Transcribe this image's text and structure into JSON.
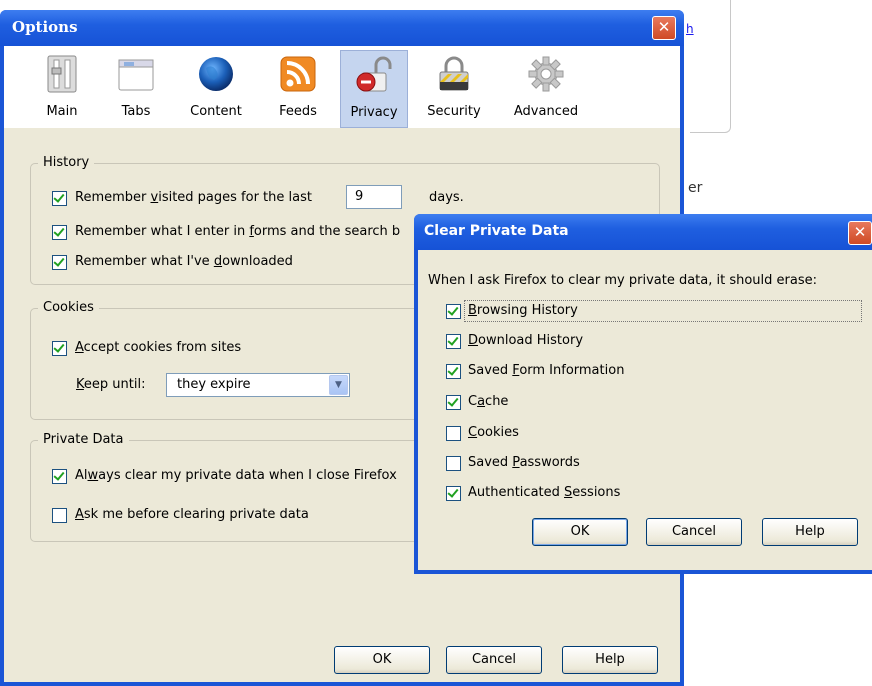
{
  "background": {
    "link_text": "h",
    "side_text": "er"
  },
  "options": {
    "title": "Options",
    "close_glyph": "✕",
    "tabs": [
      {
        "label": "Main",
        "icon": "main-switch-icon"
      },
      {
        "label": "Tabs",
        "icon": "tabs-window-icon"
      },
      {
        "label": "Content",
        "icon": "globe-icon"
      },
      {
        "label": "Feeds",
        "icon": "rss-feed-icon"
      },
      {
        "label": "Privacy",
        "icon": "padlock-open-icon",
        "selected": true
      },
      {
        "label": "Security",
        "icon": "padlock-closed-icon"
      },
      {
        "label": "Advanced",
        "icon": "gear-icon"
      }
    ],
    "history": {
      "title": "History",
      "remember_visited_pre": "Remember ",
      "remember_visited_u": "v",
      "remember_visited_post": "isited pages for the last",
      "days_value": "9",
      "days_label": "days.",
      "remember_forms_pre": "Remember what I enter in ",
      "remember_forms_u": "f",
      "remember_forms_post": "orms and the search b",
      "remember_downloads_pre": "Remember what I've ",
      "remember_downloads_u": "d",
      "remember_downloads_post": "ownloaded"
    },
    "cookies": {
      "title": "Cookies",
      "accept_u": "A",
      "accept_post": "ccept cookies from sites",
      "keep_until_u": "K",
      "keep_until_post": "eep until:",
      "keep_until_value": "they expire"
    },
    "private_data": {
      "title": "Private Data",
      "always_clear_pre": "Al",
      "always_clear_u": "w",
      "always_clear_post": "ays clear my private data when I close Firefox",
      "ask_u": "A",
      "ask_post": "sk me before clearing private data"
    },
    "buttons": {
      "ok": "OK",
      "cancel": "Cancel",
      "help": "Help"
    }
  },
  "clear_private_data": {
    "title": "Clear Private Data",
    "close_glyph": "✕",
    "prompt": "When I ask Firefox to clear my private data, it should erase:",
    "items": [
      {
        "pre": "",
        "u": "B",
        "post": "rowsing History",
        "checked": true
      },
      {
        "pre": "",
        "u": "D",
        "post": "ownload History",
        "checked": true
      },
      {
        "pre": "Saved ",
        "u": "F",
        "post": "orm Information",
        "checked": true
      },
      {
        "pre": "C",
        "u": "a",
        "post": "che",
        "checked": true
      },
      {
        "pre": "",
        "u": "C",
        "post": "ookies",
        "checked": false
      },
      {
        "pre": "Saved ",
        "u": "P",
        "post": "asswords",
        "checked": false
      },
      {
        "pre": "Authenticated ",
        "u": "S",
        "post": "essions",
        "checked": true
      }
    ],
    "buttons": {
      "ok": "OK",
      "cancel": "Cancel",
      "help": "Help"
    }
  }
}
